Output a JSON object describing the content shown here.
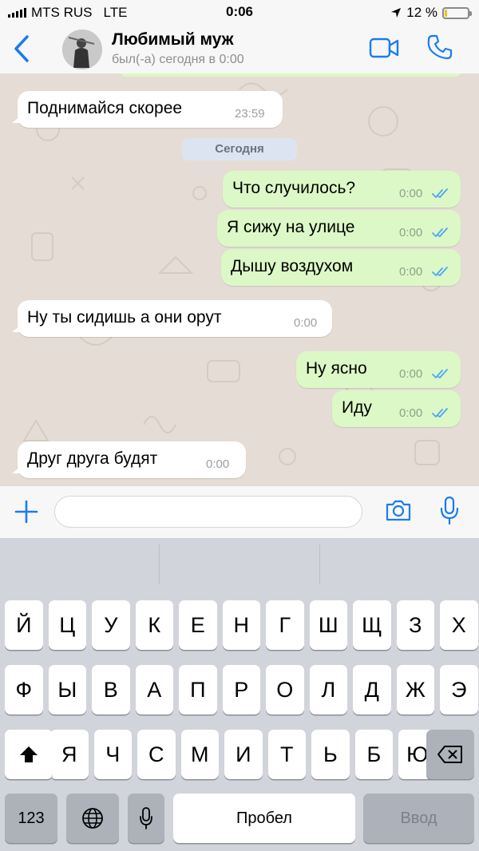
{
  "status": {
    "carrier": "MTS RUS",
    "network": "LTE",
    "time": "0:06",
    "battery": "12 %",
    "battery_level": 0.12
  },
  "header": {
    "back_icon": "chevron-left-icon",
    "contact_name": "Любимый муж",
    "last_seen": "был(-а) сегодня в 0:00",
    "video_icon": "video-call-icon",
    "phone_icon": "phone-icon",
    "accent": "#1a7cf2"
  },
  "chat": {
    "date_separator": "Сегодня",
    "messages": [
      {
        "dir": "in",
        "text": "Поднимайся скорее",
        "time": "23:59"
      },
      {
        "dir": "out",
        "text": "Что случилось?",
        "time": "0:00"
      },
      {
        "dir": "out",
        "text": "Я сижу на улице",
        "time": "0:00"
      },
      {
        "dir": "out",
        "text": "Дышу воздухом",
        "time": "0:00"
      },
      {
        "dir": "in",
        "text": "Ну ты сидишь а они орут",
        "time": "0:00"
      },
      {
        "dir": "out",
        "text": "Ну ясно",
        "time": "0:00"
      },
      {
        "dir": "out",
        "text": "Иду",
        "time": "0:00"
      },
      {
        "dir": "in",
        "text": "Друг друга будят",
        "time": "0:00"
      }
    ],
    "read_tick_color": "#4fa5f5",
    "outgoing_color": "#dcf8c6"
  },
  "input": {
    "placeholder": "",
    "value": "",
    "attach_icon": "plus-icon",
    "camera_icon": "camera-icon",
    "mic_icon": "microphone-icon"
  },
  "keyboard": {
    "row1": [
      "Й",
      "Ц",
      "У",
      "К",
      "Е",
      "Н",
      "Г",
      "Ш",
      "Щ",
      "З",
      "Х"
    ],
    "row2": [
      "Ф",
      "Ы",
      "В",
      "А",
      "П",
      "Р",
      "О",
      "Л",
      "Д",
      "Ж",
      "Э"
    ],
    "row3": [
      "Я",
      "Ч",
      "С",
      "М",
      "И",
      "Т",
      "Ь",
      "Б",
      "Ю"
    ],
    "shift_icon": "shift-icon",
    "delete_icon": "backspace-icon",
    "numbers_label": "123",
    "globe_icon": "globe-icon",
    "dictation_icon": "microphone-icon",
    "space_label": "Пробел",
    "return_label": "Ввод"
  }
}
